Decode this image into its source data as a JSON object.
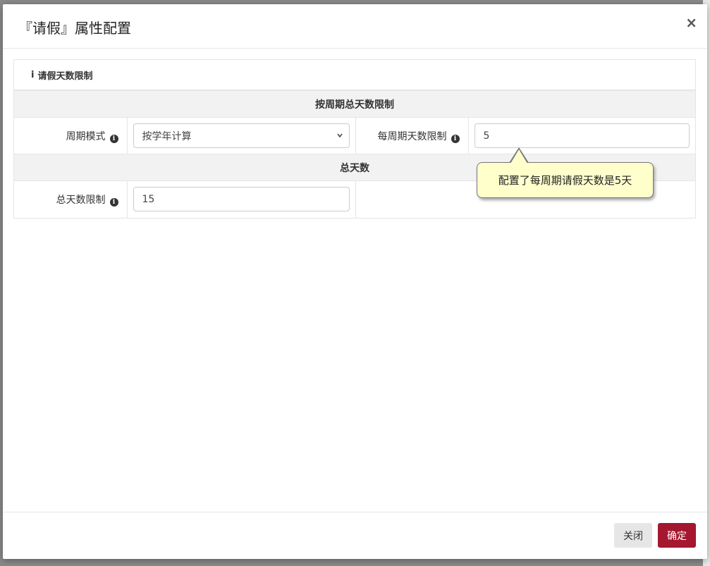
{
  "dialog": {
    "title": "『请假』属性配置",
    "close_symbol": "×"
  },
  "panel": {
    "heading_icon": "i",
    "heading": "请假天数限制"
  },
  "sections": {
    "period": "按周期总天数限制",
    "total": "总天数"
  },
  "fields": {
    "period_mode_label": "周期模式",
    "period_mode_value": "按学年计算",
    "per_period_label": "每周期天数限制",
    "per_period_value": "5",
    "total_label": "总天数限制",
    "total_value": "15"
  },
  "tooltip": {
    "text": "配置了每周期请假天数是5天"
  },
  "footer": {
    "close_label": "关闭",
    "ok_label": "确定"
  },
  "colors": {
    "primary": "#a4172f",
    "tooltip_bg": "#ffffcc"
  }
}
